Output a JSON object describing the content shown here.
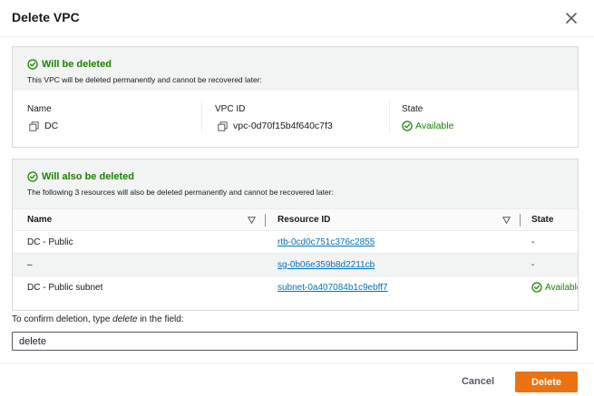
{
  "dialog": {
    "title": "Delete VPC",
    "close_icon": "close-icon"
  },
  "will_be_deleted": {
    "heading": "Will be deleted",
    "description": "This VPC will be deleted permanently and cannot be recovered later:",
    "fields": {
      "name_label": "Name",
      "name_value": "DC",
      "vpc_id_label": "VPC ID",
      "vpc_id_value": "vpc-0d70f15b4f640c7f3",
      "state_label": "State",
      "state_value": "Available"
    }
  },
  "will_also_be_deleted": {
    "heading": "Will also be deleted",
    "description": "The following 3 resources will also be deleted permanently and cannot be recovered later:",
    "columns": [
      "Name",
      "Resource ID",
      "State"
    ],
    "rows": [
      {
        "name": "DC - Public",
        "resource_id": "rtb-0cd0c751c376c2855",
        "state": "-"
      },
      {
        "name": "–",
        "resource_id": "sg-0b06e359b8d2211cb",
        "state": "-"
      },
      {
        "name": "DC - Public subnet",
        "resource_id": "subnet-0a407084b1c9ebff7",
        "state": "Available"
      }
    ]
  },
  "confirm": {
    "label_prefix": "To confirm deletion, type ",
    "label_keyword": "delete",
    "label_suffix": " in the field:",
    "input_value": "delete"
  },
  "footer": {
    "cancel_label": "Cancel",
    "delete_label": "Delete"
  },
  "colors": {
    "success": "#1d8102",
    "link": "#0073bb",
    "primary": "#ec7211"
  }
}
